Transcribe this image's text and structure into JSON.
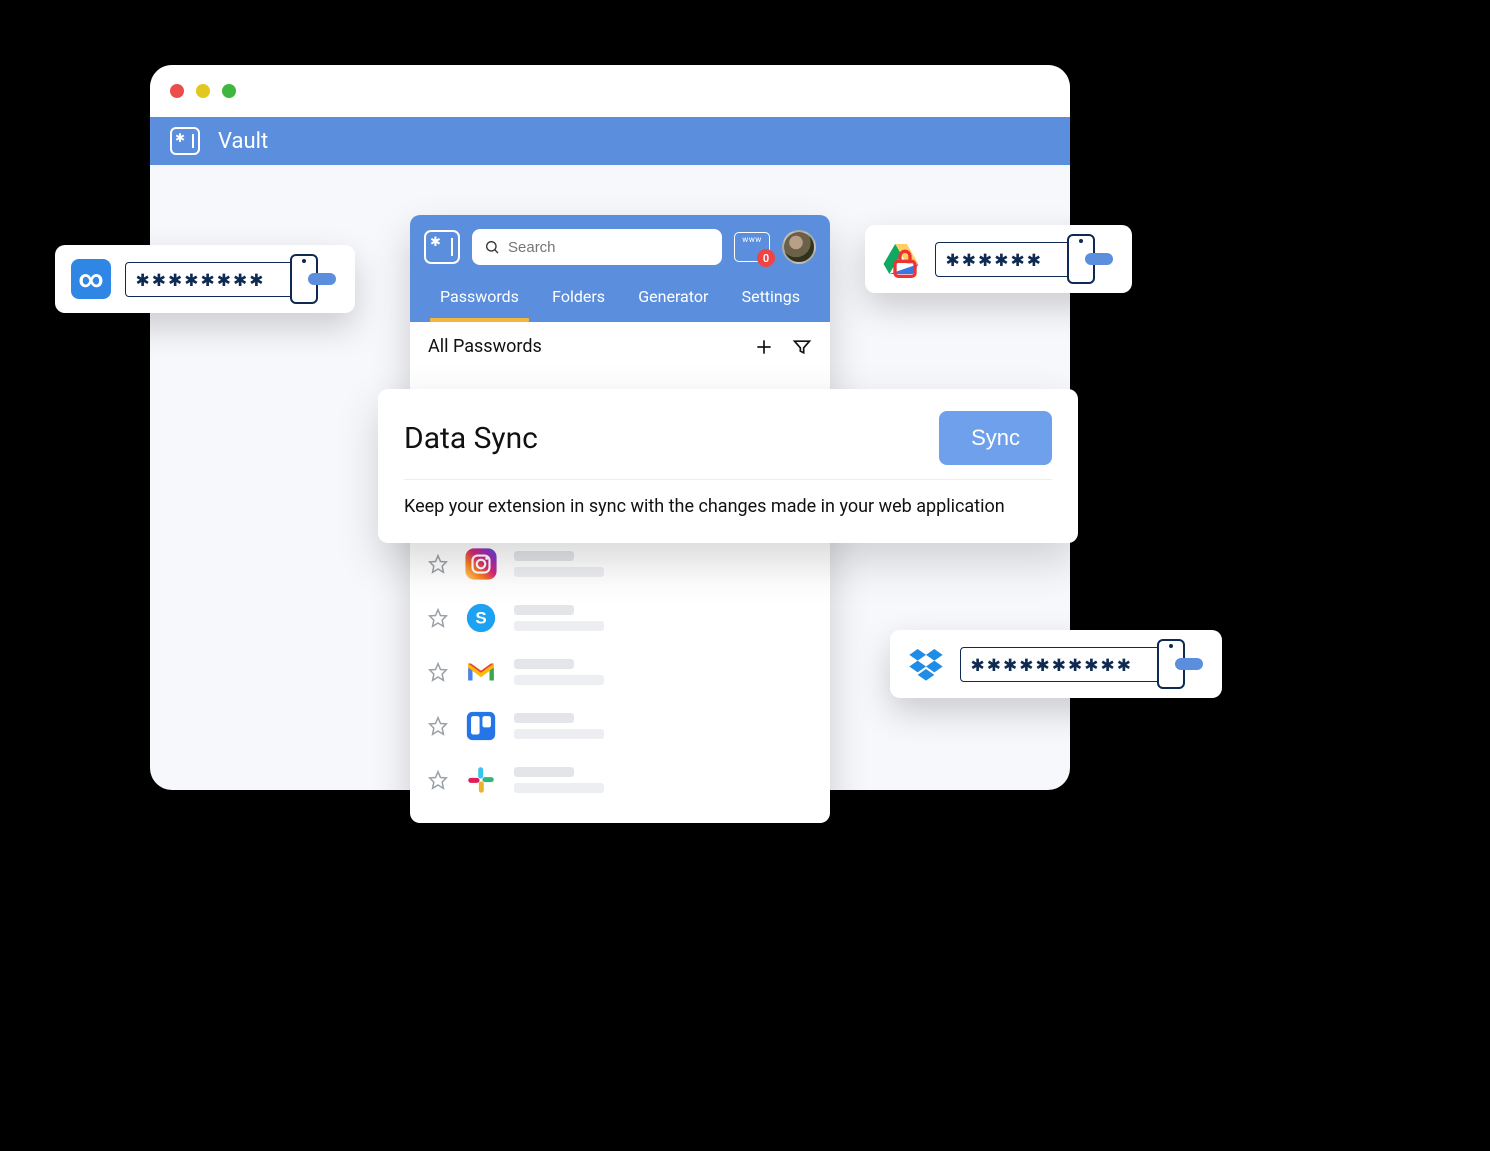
{
  "colors": {
    "primary": "#5b8fde",
    "accent_tab": "#f1b63c",
    "badge": "#e44"
  },
  "window": {
    "title": "Vault"
  },
  "extension": {
    "search": {
      "placeholder": "Search"
    },
    "www_badge_count": "0",
    "tabs": [
      {
        "label": "Passwords",
        "active": true
      },
      {
        "label": "Folders",
        "active": false
      },
      {
        "label": "Generator",
        "active": false
      },
      {
        "label": "Settings",
        "active": false
      }
    ],
    "section_title": "All Passwords",
    "items": [
      {
        "service": "instagram"
      },
      {
        "service": "skype"
      },
      {
        "service": "gmail"
      },
      {
        "service": "trello"
      },
      {
        "service": "slack"
      }
    ]
  },
  "sync": {
    "title": "Data Sync",
    "button": "Sync",
    "description": "Keep your extension in sync with the changes made in your web application"
  },
  "cards": {
    "left": {
      "service": "infinity",
      "masked": "✱✱✱✱✱✱✱✱"
    },
    "right": {
      "service": "drive",
      "masked": "✱✱✱✱✱✱"
    },
    "bottom": {
      "service": "dropbox",
      "masked": "✱✱✱✱✱✱✱✱✱✱"
    }
  }
}
